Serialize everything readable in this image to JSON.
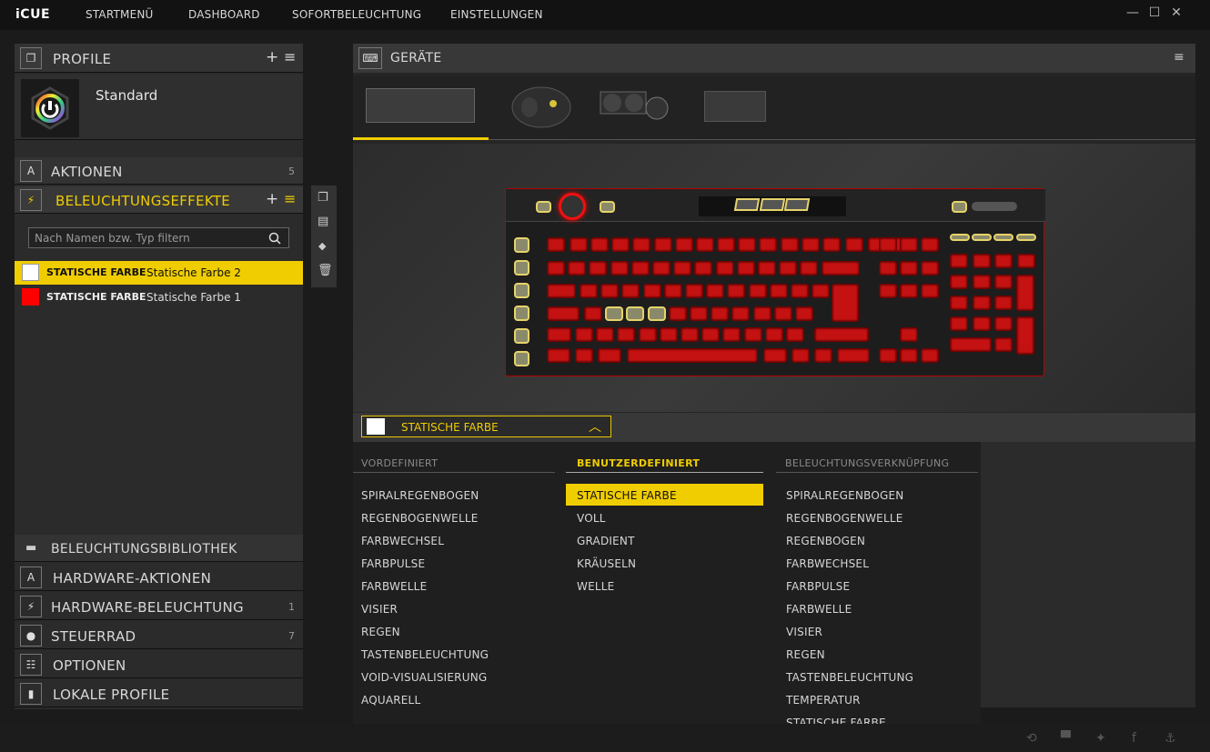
{
  "app": {
    "logo": "iCUE"
  },
  "nav": {
    "items": [
      "STARTMENÜ",
      "DASHBOARD",
      "SOFORTBELEUCHTUNG",
      "EINSTELLUNGEN"
    ]
  },
  "window": {
    "minimize": "—",
    "maximize": "☐",
    "close": "✕"
  },
  "profile": {
    "header": "PROFILE",
    "name": "Standard"
  },
  "sections": {
    "aktionen": {
      "label": "AKTIONEN",
      "count": "5"
    },
    "beleuchtung": {
      "label": "BELEUCHTUNGSEFFEKTE"
    },
    "bibliothek": {
      "label": "BELEUCHTUNGSBIBLIOTHEK"
    },
    "hw_aktionen": {
      "label": "HARDWARE-AKTIONEN"
    },
    "hw_beleuchtung": {
      "label": "HARDWARE-BELEUCHTUNG",
      "count": "1"
    },
    "steuerrad": {
      "label": "STEUERRAD",
      "count": "7"
    },
    "optionen": {
      "label": "OPTIONEN"
    },
    "lokale": {
      "label": "LOKALE PROFILE"
    }
  },
  "filter": {
    "placeholder": "Nach Namen bzw. Typ filtern"
  },
  "effects": [
    {
      "type": "STATISCHE FARBE",
      "name": "Statische Farbe 2",
      "color": "#ffffff",
      "selected": true
    },
    {
      "type": "STATISCHE FARBE",
      "name": "Statische Farbe 1",
      "color": "#ff0000",
      "selected": false
    }
  ],
  "devices": {
    "header": "GERÄTE"
  },
  "effect_select": {
    "label": "STATISCHE FARBE"
  },
  "columns": {
    "vordefiniert": {
      "title": "VORDEFINIERT",
      "items": [
        "SPIRALREGENBOGEN",
        "REGENBOGENWELLE",
        "FARBWECHSEL",
        "FARBPULSE",
        "FARBWELLE",
        "VISIER",
        "REGEN",
        "TASTENBELEUCHTUNG",
        "VOID-VISUALISIERUNG",
        "AQUARELL"
      ]
    },
    "benutzer": {
      "title": "BENUTZERDEFINIERT",
      "items": [
        "STATISCHE FARBE",
        "VOLL",
        "GRADIENT",
        "KRÄUSELN",
        "WELLE"
      ]
    },
    "verknuepfung": {
      "title": "BELEUCHTUNGSVERKNÜPFUNG",
      "items": [
        "SPIRALREGENBOGEN",
        "REGENBOGENWELLE",
        "REGENBOGEN",
        "FARBWECHSEL",
        "FARBPULSE",
        "FARBWELLE",
        "VISIER",
        "REGEN",
        "TASTENBELEUCHTUNG",
        "TEMPERATUR",
        "STATISCHE FARBE"
      ]
    }
  },
  "colors": {
    "accent": "#f0cd00",
    "key_red": "#c41111"
  }
}
